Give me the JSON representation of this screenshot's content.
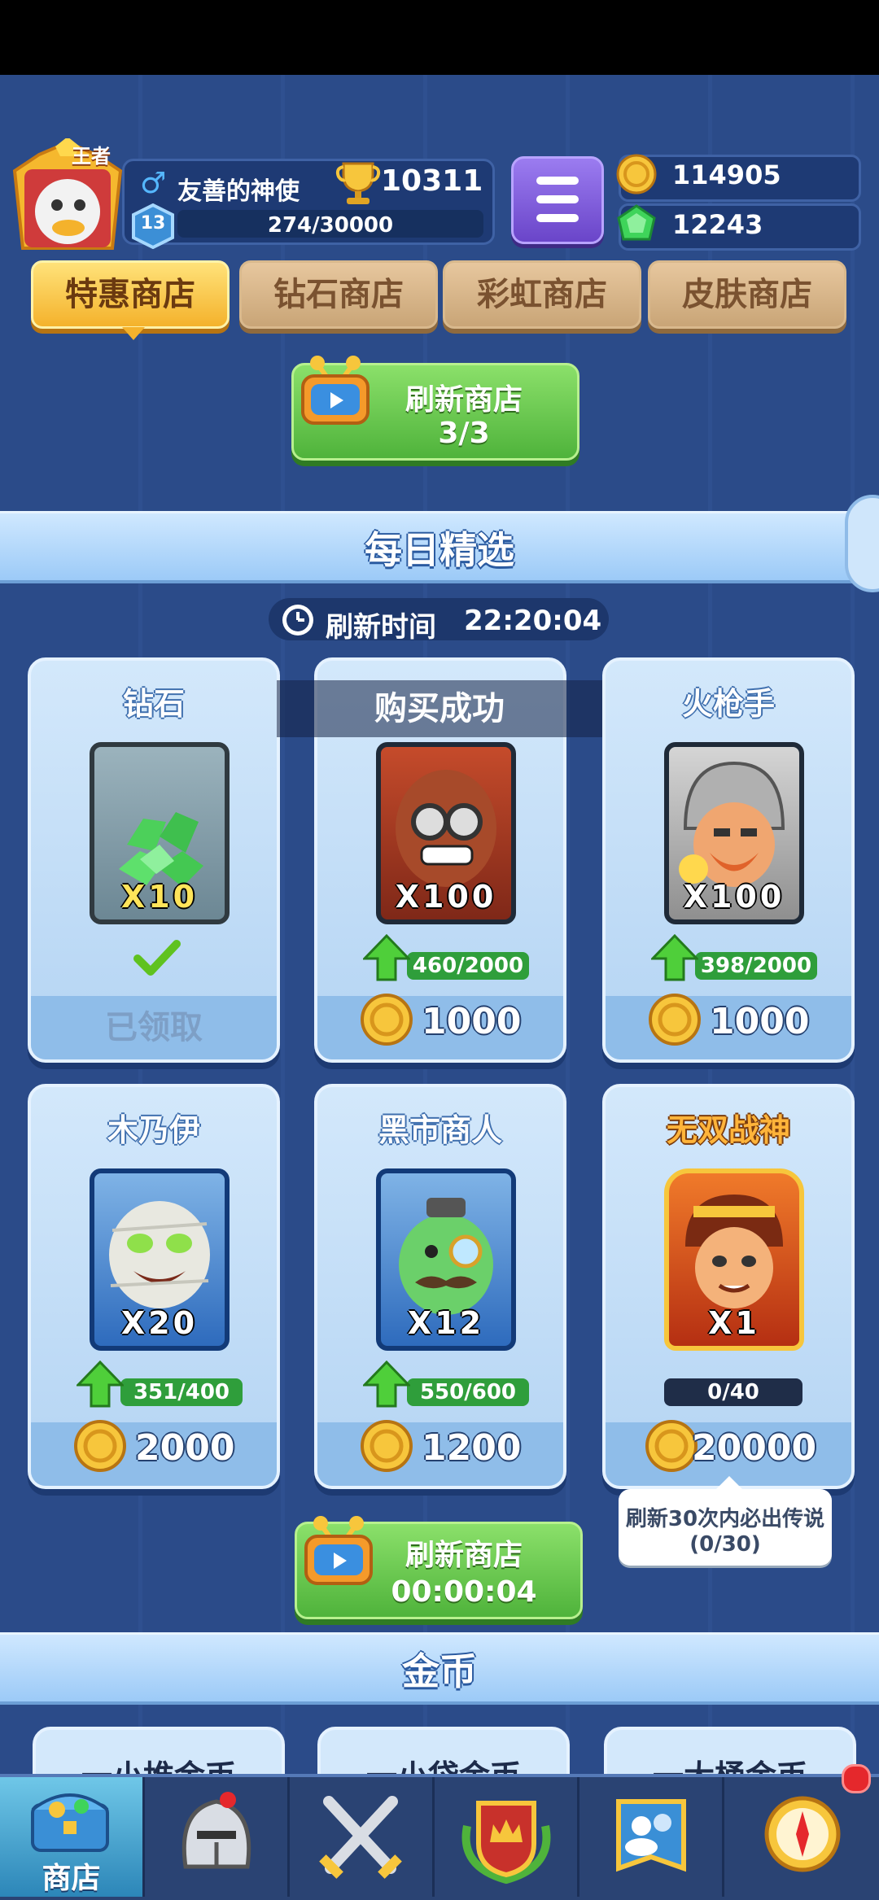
{
  "player": {
    "name": "友善的神使",
    "rank_badge": "王者",
    "trophies": "10311",
    "level": "13",
    "xp": "274/30000"
  },
  "currency": {
    "gold": "114905",
    "gems": "12243"
  },
  "tabs": [
    {
      "label": "特惠商店",
      "active": true
    },
    {
      "label": "钻石商店",
      "active": false
    },
    {
      "label": "彩虹商店",
      "active": false
    },
    {
      "label": "皮肤商店",
      "active": false
    }
  ],
  "top_refresh": {
    "label": "刷新商店",
    "count": "3/3"
  },
  "daily": {
    "title": "每日精选",
    "refresh_label": "刷新时间",
    "refresh_time": "22:20:04"
  },
  "toast": "购买成功",
  "cards": [
    {
      "title": "钻石",
      "qty": "X10",
      "status": "已领取"
    },
    {
      "title": "",
      "qty": "X100",
      "progress": "460/2000",
      "price": "1000"
    },
    {
      "title": "火枪手",
      "qty": "X100",
      "progress": "398/2000",
      "price": "1000"
    },
    {
      "title": "木乃伊",
      "qty": "X20",
      "progress": "351/400",
      "price": "2000"
    },
    {
      "title": "黑市商人",
      "qty": "X12",
      "progress": "550/600",
      "price": "1200"
    },
    {
      "title": "无双战神",
      "qty": "X1",
      "progress": "0/40",
      "price": "20000"
    }
  ],
  "tooltip": {
    "line1": "刷新30次内必出传说",
    "line2": "(0/30)"
  },
  "bottom_refresh": {
    "label": "刷新商店",
    "timer": "00:00:04"
  },
  "gold_section": {
    "title": "金币",
    "items": [
      "一小堆金币",
      "一小袋金币",
      "一大桶金币"
    ]
  },
  "nav": {
    "items": [
      {
        "icon": "treasure-chest-icon",
        "label": "商店",
        "active": true
      },
      {
        "icon": "knight-helmet-icon",
        "label": "",
        "active": false
      },
      {
        "icon": "crossed-swords-icon",
        "label": "",
        "active": false
      },
      {
        "icon": "crown-shield-icon",
        "label": "",
        "active": false
      },
      {
        "icon": "social-banner-icon",
        "label": "",
        "active": false
      },
      {
        "icon": "compass-icon",
        "label": "",
        "active": false
      }
    ]
  },
  "colors": {
    "accent_gold": "#f4b22c",
    "green": "#4fb33b",
    "background": "#2b4b89"
  }
}
